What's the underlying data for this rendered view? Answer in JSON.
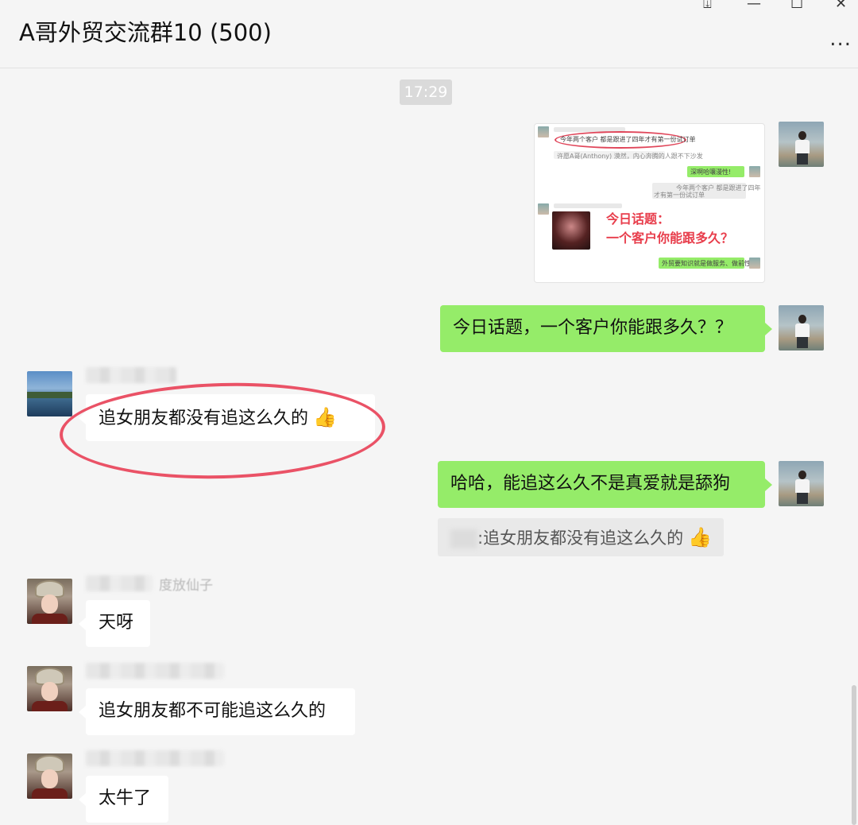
{
  "window": {
    "title": "A哥外贸交流群10 (500)",
    "controls": {
      "pin": "⍗",
      "minimize": "—",
      "maximize": "☐",
      "close": "✕"
    },
    "more": "..."
  },
  "chat": {
    "timestamp": "17:29",
    "messages": [
      {
        "sender": "me",
        "type": "image",
        "image": {
          "lines": [
            "今年两个客户 都是跟进了四年才有第一份试订单",
            "许愿A哥(Anthony) 漠然，内心奔腾的人跟不下沙发",
            "深啊哈嚷漫性!",
            "今年两个客户 都是跟进了四年",
            "才有第一份试订单",
            "外贸要知识就是做服务、做前性"
          ],
          "topic_line1": "今日话题：",
          "topic_line2": "一个客户你能跟多久？"
        }
      },
      {
        "sender": "me",
        "type": "text",
        "text": "今日话题，一个客户你能跟多久？？"
      },
      {
        "sender": "other",
        "type": "text",
        "text": "追女朋友都没有追这么久的",
        "emoji": "👍"
      },
      {
        "sender": "me",
        "type": "text",
        "text": "哈哈，能追这么久不是真爱就是舔狗",
        "quote": {
          "text": ":追女朋友都没有追这么久的",
          "emoji": "👍"
        }
      },
      {
        "sender": "other",
        "type": "text",
        "nickname": "度放仙子",
        "text": "天呀"
      },
      {
        "sender": "other",
        "type": "text",
        "text": "追女朋友都不可能追这么久的"
      },
      {
        "sender": "other",
        "type": "text",
        "text": "太牛了"
      }
    ]
  },
  "icons": {
    "thumbs_up": "thumbs-up-emoji",
    "more": "ellipsis-icon"
  },
  "colors": {
    "my_bubble": "#95ec69",
    "other_bubble": "#ffffff",
    "highlight": "#ea5266",
    "background": "#f5f5f5"
  }
}
